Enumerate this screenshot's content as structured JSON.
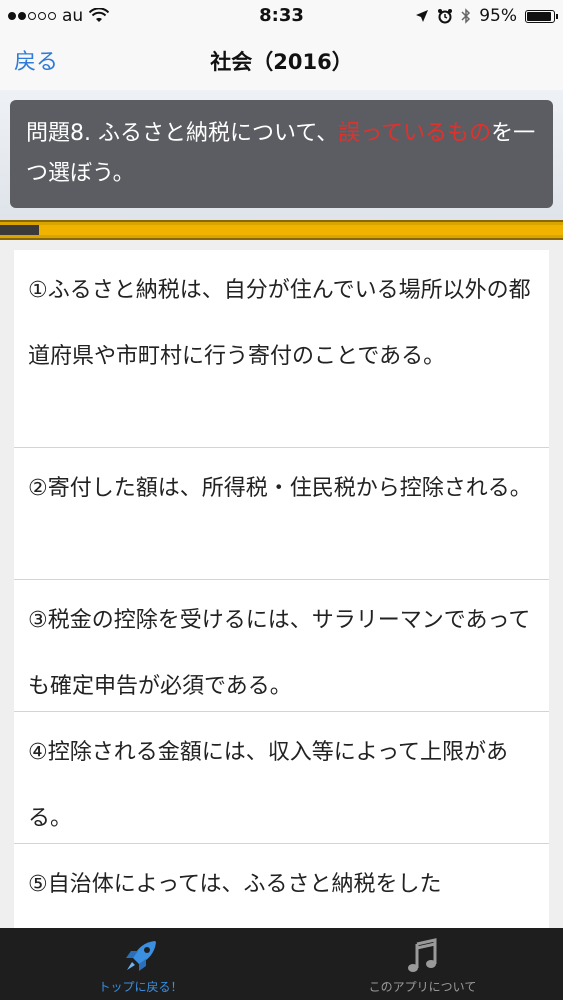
{
  "status_bar": {
    "carrier": "au",
    "time": "8:33",
    "battery": "95%"
  },
  "nav": {
    "back_label": "戻る",
    "title": "社会（2016）"
  },
  "question": {
    "prefix": "問題8. ふるさと納税について、",
    "highlight": "誤っているもの",
    "suffix": "を一つ選ぼう。"
  },
  "progress": {
    "fraction": 0.07
  },
  "options": [
    {
      "text": "①ふるさと納税は、自分が住んでいる場所以外の都道府県や市町村に行う寄付のことである。"
    },
    {
      "text": "②寄付した額は、所得税・住民税から控除される。"
    },
    {
      "text": "③税金の控除を受けるには、サラリーマンであっても確定申告が必須である。"
    },
    {
      "text": "④控除される金額には、収入等によって上限がある。"
    },
    {
      "text": "⑤自治体によっては、ふるさと納税をした"
    }
  ],
  "tab_bar": {
    "tabs": [
      {
        "label": "トップに戻る！",
        "icon": "rocket-icon",
        "active": true
      },
      {
        "label": "このアプリについて",
        "icon": "music-note-icon",
        "active": false
      }
    ]
  },
  "colors": {
    "accent": "#2f7bd6",
    "highlight_red": "#e0322c",
    "progress_gold": "#f0b400",
    "question_bg": "#5b5d62",
    "tab_bar_bg": "#1e1e1e"
  }
}
